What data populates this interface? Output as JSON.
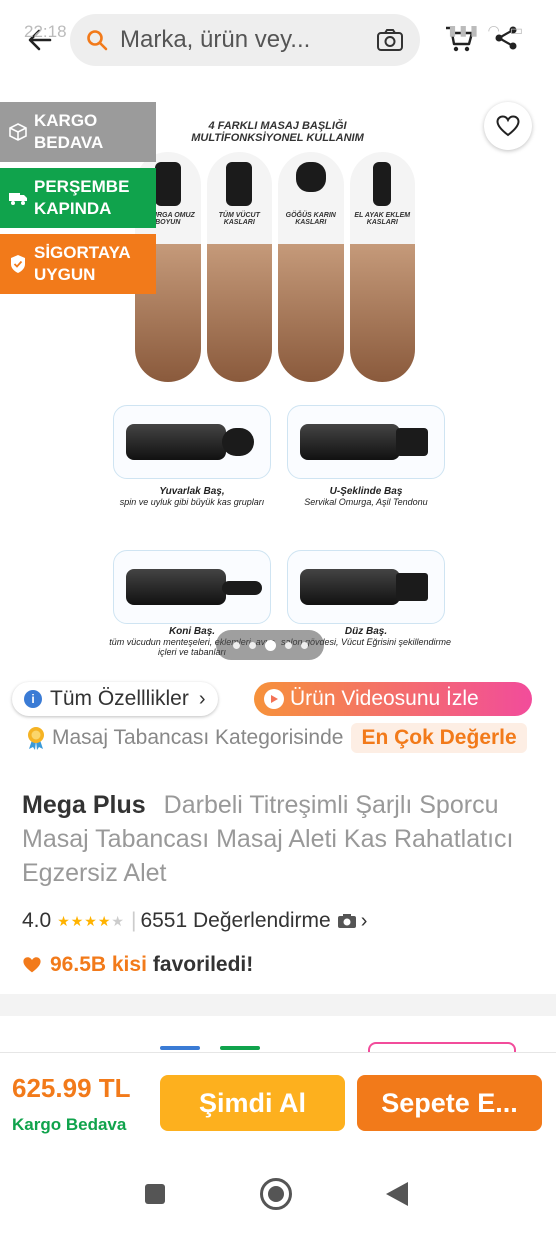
{
  "status_bar": {
    "time": "22:18",
    "battery": "25"
  },
  "search": {
    "placeholder": "Marka, ürün vey..."
  },
  "gallery": {
    "poster_title_line1": "4 FARKLI MASAJ BAŞLIĞI",
    "poster_title_line2": "MULTİFONKSİYONEL KULLANIM",
    "heads": [
      {
        "label": "OMURGA OMUZ BOYUN"
      },
      {
        "label": "TÜM VÜCUT KASLARI"
      },
      {
        "label": "GÖĞÜS KARIN KASLARI"
      },
      {
        "label": "EL AYAK EKLEM KASLARI"
      }
    ],
    "tiles": [
      {
        "title": "Yuvarlak Baş,",
        "desc": "spin ve uyluk gibi büyük kas grupları"
      },
      {
        "title": "U-Şeklinde Baş",
        "desc": "Servikal Omurga, Aşil Tendonu"
      },
      {
        "title": "Koni Baş.",
        "desc": "tüm vücudun menteşeleri, eklemleri, avuç içleri ve tabanları"
      },
      {
        "title": "Düz Baş.",
        "desc": "salon gövdesi, Vücut Eğrisini şekillendirme"
      }
    ],
    "dot_count": 5,
    "active_dot": 2
  },
  "badges": {
    "cargo": "KARGO BEDAVA",
    "thursday": "PERŞEMBE KAPINDA",
    "insurance": "SİGORTAYA UYGUN"
  },
  "chips": {
    "specs": "Tüm Özelllikler",
    "video": "Ürün Videosunu İzle"
  },
  "category": {
    "text": "Masaj Tabancası Kategorisinde",
    "highlight": "En Çok Değerle"
  },
  "product": {
    "brand": "Mega Plus",
    "title": "Darbeli Titreşimli Şarjlı Sporcu Masaj Tabancası Masaj Aleti Kas Rahatlatıcı Egzersiz Alet",
    "rating": "4.0",
    "stars_filled": 4,
    "stars_total": 5,
    "review_count": "6551 Değerlendirme",
    "favorites_count": "96.5B kisi",
    "favorites_text": "favoriledi!"
  },
  "buy_bar": {
    "price": "625.99 TL",
    "shipping": "Kargo Bedava",
    "buy_now": "Şimdi Al",
    "add_to_cart": "Sepete E..."
  },
  "colors": {
    "brand_orange": "#f27a1a",
    "green": "#10a34c",
    "yellow": "#fdb01e",
    "grey_badge": "#9b9b9b"
  }
}
